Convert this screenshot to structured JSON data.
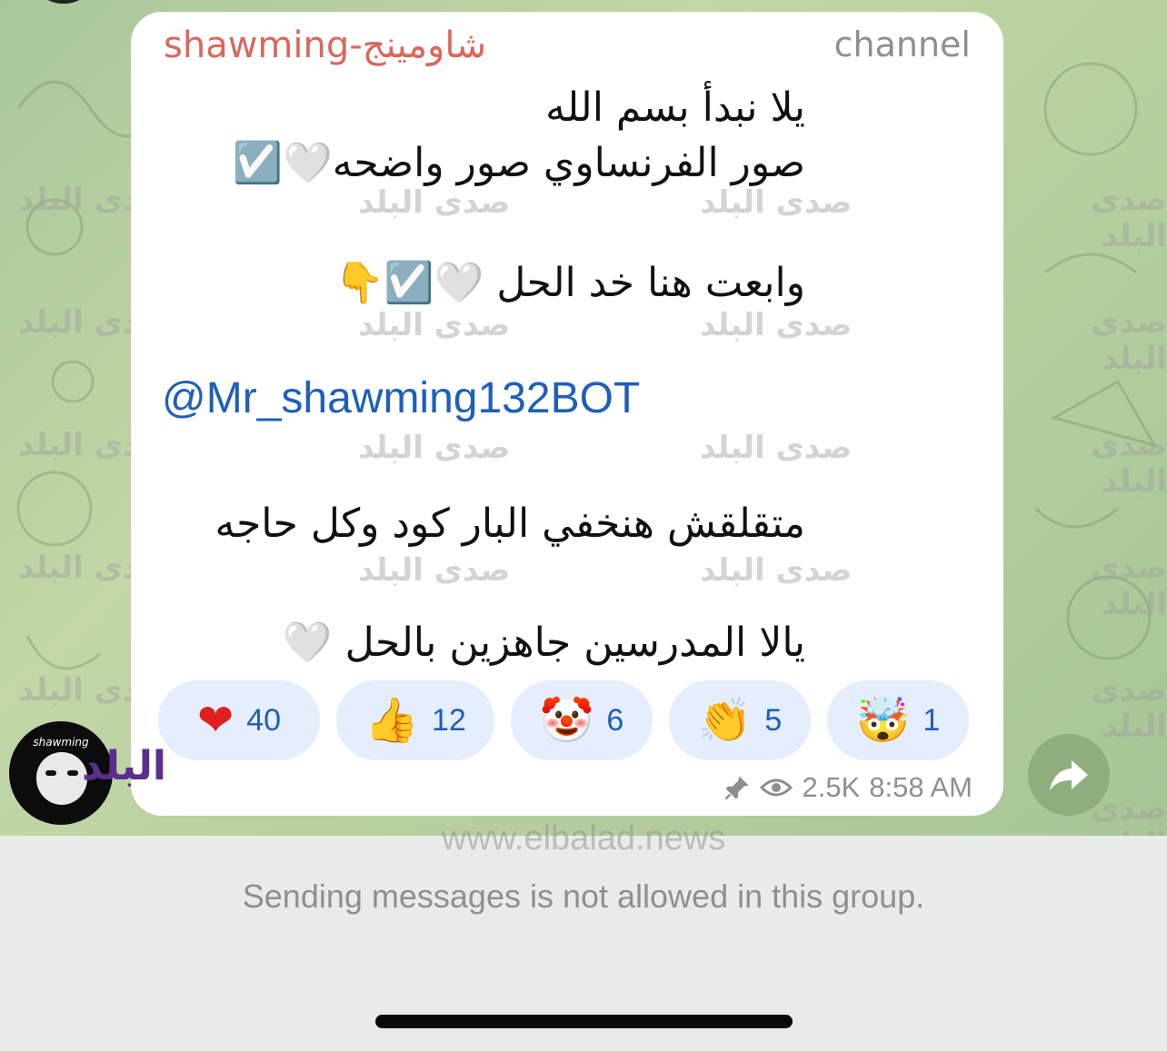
{
  "channel": {
    "sender_name": "shawming-شاومينج",
    "author_signature": "channel",
    "avatar_caption": "shawming"
  },
  "message": {
    "lines": [
      "يلا نبدأ بسم الله",
      "صور الفرنساوي صور واضحه🤍☑️",
      "وابعت هنا خد الحل 🤍☑️👇",
      "متقلقش هنخفي البار كود وكل حاجه",
      "يالا المدرسين جاهزين بالحل 🤍"
    ],
    "mention": "@Mr_shawming132BOT"
  },
  "reactions": [
    {
      "emoji": "❤",
      "count": "40",
      "icon": "red-heart-icon"
    },
    {
      "emoji": "👍",
      "count": "12",
      "icon": "thumbs-up-icon"
    },
    {
      "emoji": "🤡",
      "count": "6",
      "icon": "clown-face-icon"
    },
    {
      "emoji": "👏",
      "count": "5",
      "icon": "clapping-hands-icon"
    },
    {
      "emoji": "🤯",
      "count": "1",
      "icon": "exploding-head-icon"
    }
  ],
  "meta": {
    "views": "2.5K",
    "time": "8:58 AM"
  },
  "watermark": {
    "text": "صدى البلد",
    "site": "www.elbalad.news",
    "brand": "البلد"
  },
  "composer": {
    "notice": "Sending messages is not allowed in this group."
  },
  "colors": {
    "sender": "#d9675c",
    "link": "#1f5fb8",
    "reaction_bg": "#e5eefc",
    "chat_bg": "#b7d0a0"
  }
}
